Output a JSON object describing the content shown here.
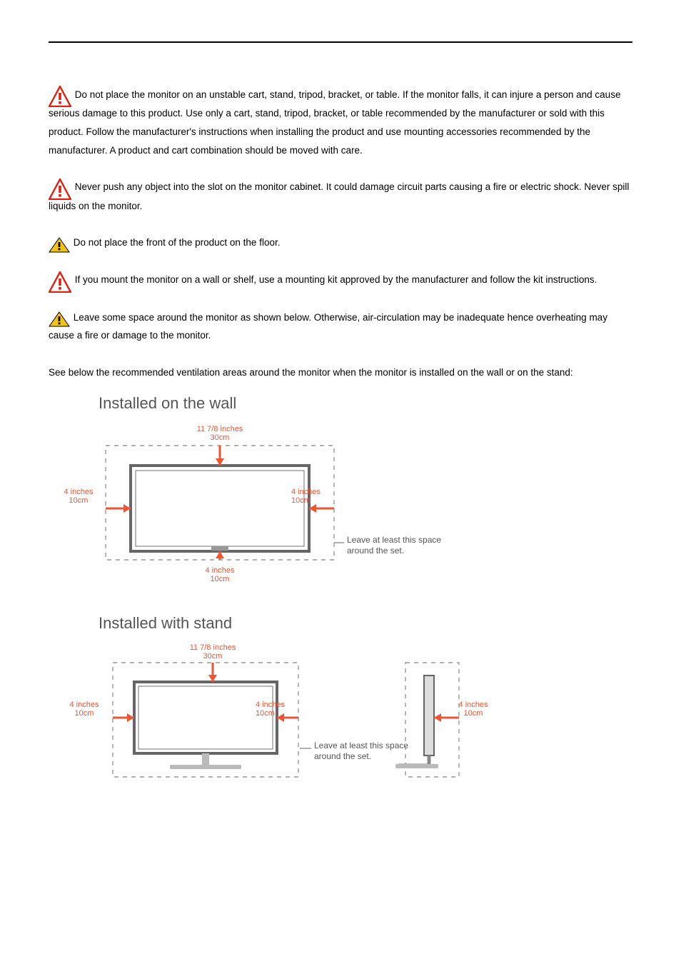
{
  "warnings": {
    "w1": "Do not place the monitor on an unstable cart, stand, tripod, bracket, or table. If the monitor falls, it can injure a person and cause serious damage to this product. Use only a cart, stand, tripod, bracket, or table recommended by the manufacturer or sold with this product. Follow the manufacturer's instructions when installing the product and use mounting accessories recommended by the manufacturer. A product and cart combination should be moved with care.",
    "w2": "Never push any object into the slot on the monitor cabinet. It could damage circuit parts causing a fire or electric shock. Never spill liquids on the monitor.",
    "w3": "Do not place the front of the product on the floor.",
    "w4": "If you mount the monitor on a wall or shelf, use a mounting kit approved by the manufacturer and follow the kit instructions.",
    "w5": "Leave some space around the monitor as shown below. Otherwise, air-circulation may be inadequate hence overheating may cause a fire or damage to the monitor."
  },
  "intro": "See below the recommended ventilation areas around the monitor when the monitor is installed on the wall or on the stand:",
  "headings": {
    "wall": "Installed on the wall",
    "stand": "Installed with stand"
  },
  "diagram": {
    "top_in": "11 7/8 inches",
    "top_cm": "30cm",
    "side_in": "4 inches",
    "side_cm": "10cm",
    "bottom_in": "4 inches",
    "bottom_cm": "10cm",
    "note_l1": "Leave at least this space",
    "note_l2": "around the set."
  }
}
